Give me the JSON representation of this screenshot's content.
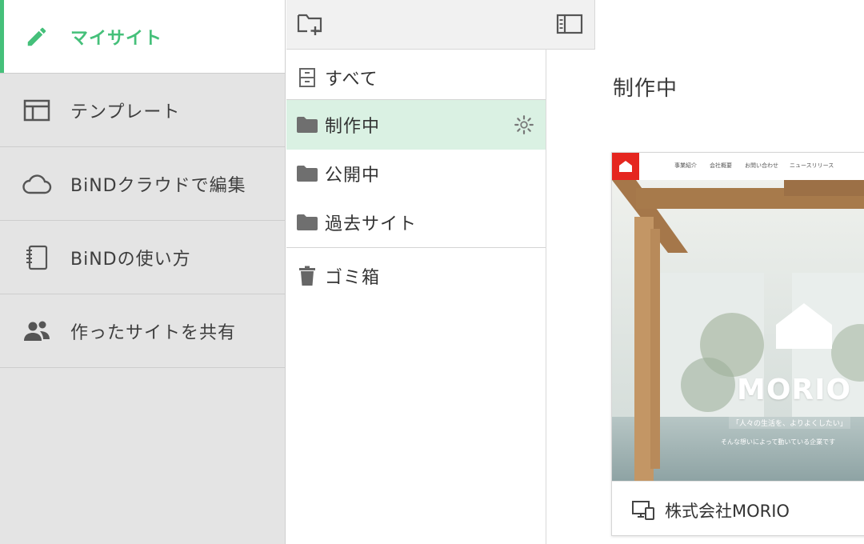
{
  "nav": {
    "items": [
      {
        "label": "マイサイト",
        "icon": "pencil-icon",
        "active": true
      },
      {
        "label": "テンプレート",
        "icon": "layout-icon"
      },
      {
        "label": "BiNDクラウドで編集",
        "icon": "cloud-icon"
      },
      {
        "label": "BiNDの使い方",
        "icon": "notebook-icon"
      },
      {
        "label": "作ったサイトを共有",
        "icon": "users-icon"
      }
    ]
  },
  "toolbar": {
    "new_folder_icon": "folder-plus-icon",
    "toggle_panel_icon": "panel-toggle-icon"
  },
  "folders": {
    "all": {
      "label": "すべて",
      "icon": "cabinet-icon"
    },
    "items": [
      {
        "label": "制作中",
        "icon": "folder-icon",
        "selected": true
      },
      {
        "label": "公開中",
        "icon": "folder-icon"
      },
      {
        "label": "過去サイト",
        "icon": "folder-icon"
      }
    ],
    "trash": {
      "label": "ゴミ箱",
      "icon": "trash-icon"
    }
  },
  "content": {
    "title": "制作中",
    "cards": [
      {
        "name": "株式会社MORIO",
        "thumbnail": {
          "menu": [
            "事業紹介",
            "会社概要",
            "お問い合わせ",
            "ニュースリリース"
          ],
          "brand": "MORIO",
          "tagline": "「人々の生活を、よりよくしたい」",
          "subline": "そんな想いによって動いている企業です"
        }
      }
    ]
  },
  "colors": {
    "accent": "#45c07a",
    "selected_bg": "#daf1e3",
    "nav_bg": "#e4e4e4",
    "logo_red": "#e5261f"
  }
}
